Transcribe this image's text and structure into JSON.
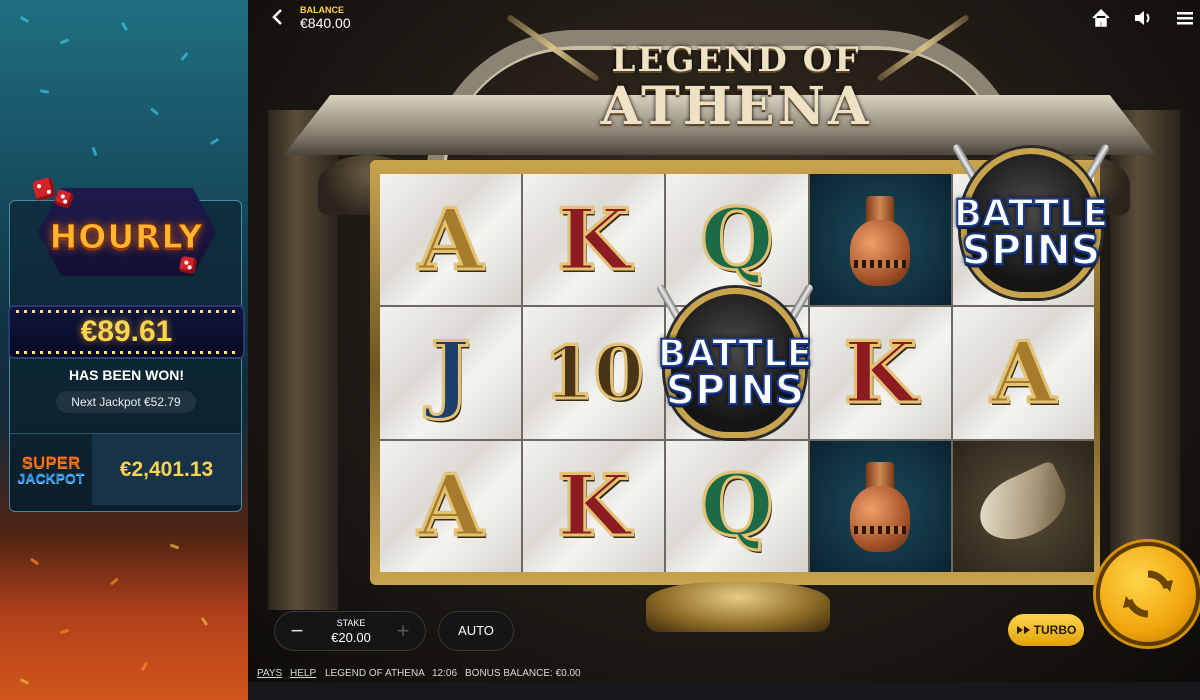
{
  "topbar": {
    "balance_label": "BALANCE",
    "balance_value": "€840.00",
    "icons": [
      "back-icon",
      "home-icon",
      "volume-icon",
      "menu-icon"
    ]
  },
  "jackpot": {
    "hourly_logo": "HOURLY",
    "won_amount": "€89.61",
    "won_text": "HAS BEEN WON!",
    "next_jackpot": "Next Jackpot €52.79",
    "super_label_line1": "SUPER",
    "super_label_line2": "JACKPOT",
    "super_amount": "€2,401.13"
  },
  "game": {
    "title_line1": "LEGEND OF",
    "title_line2": "ATHENA",
    "reels": [
      [
        "A",
        "K",
        "Q",
        "vase",
        "battle-spins"
      ],
      [
        "J",
        "10",
        "battle-spins",
        "K",
        "A"
      ],
      [
        "A",
        "K",
        "Q",
        "vase",
        "horn"
      ]
    ],
    "battle_spins_line1": "BATTLE",
    "battle_spins_line2": "SPINS"
  },
  "controls": {
    "stake_label": "STAKE",
    "stake_value": "€20.00",
    "stake_minus": "−",
    "stake_plus": "+",
    "auto_label": "AUTO",
    "turbo_label": "TURBO"
  },
  "footer": {
    "pays": "PAYS",
    "help": "HELP",
    "game_name": "LEGEND OF ATHENA",
    "time": "12:06",
    "bonus_balance": "BONUS BALANCE: €0.00"
  },
  "colors": {
    "gold_accent": "#ffd34f",
    "spin_button": "#f1a60d",
    "super_orange": "#ff7a1a",
    "jackpot_blue": "#2d8de0"
  }
}
